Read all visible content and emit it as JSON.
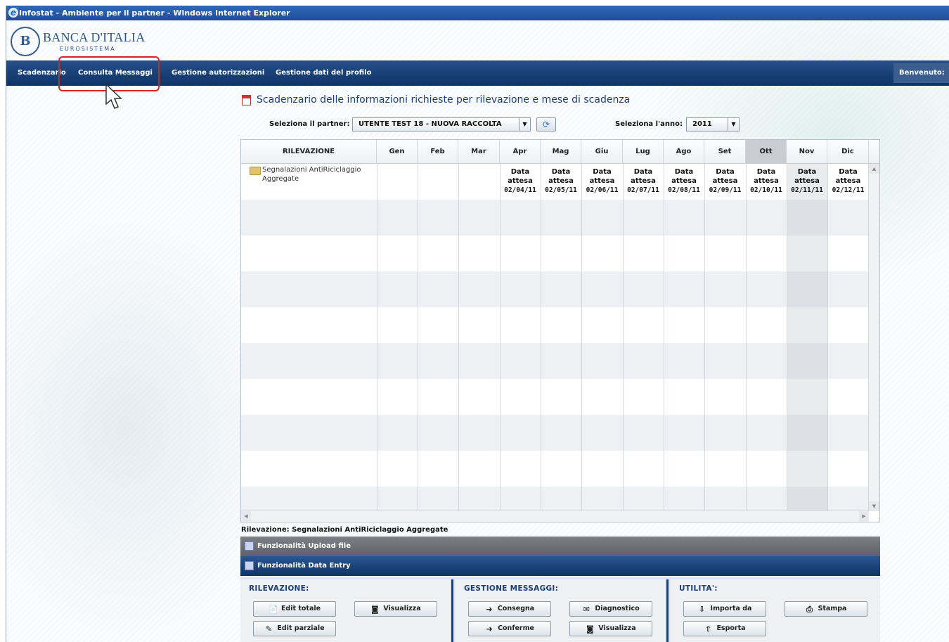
{
  "window": {
    "title": "Infostat - Ambiente per il partner - Windows Internet Explorer"
  },
  "logo": {
    "name": "BANCA D'ITALIA",
    "subtitle": "EUROSISTEMA",
    "mark": "B"
  },
  "nav": {
    "items": [
      {
        "label": "Scadenzario"
      },
      {
        "label": "Consulta Messaggi"
      },
      {
        "label": "Gestione autorizzazioni"
      },
      {
        "label": "Gestione dati del profilo"
      }
    ],
    "welcome": "Benvenuto:"
  },
  "page": {
    "title": "Scadenzario delle informazioni richieste per rilevazione e mese di scadenza"
  },
  "filters": {
    "partner_label": "Seleziona il partner:",
    "partner_value": "UTENTE TEST 18 - NUOVA RACCOLTA",
    "year_label": "Seleziona l'anno:",
    "year_value": "2011"
  },
  "grid": {
    "columns": [
      "RILEVAZIONE",
      "Gen",
      "Feb",
      "Mar",
      "Apr",
      "Mag",
      "Giu",
      "Lug",
      "Ago",
      "Set",
      "Ott",
      "Nov",
      "Dic"
    ],
    "selected_column": "Ott",
    "highlighted_cell_month": "Nov",
    "rows": [
      {
        "name": "Segnalazioni AntiRiciclaggio Aggregate",
        "cells": [
          {
            "month": "Apr",
            "line1": "Data",
            "line2": "attesa",
            "date": "02/04/11"
          },
          {
            "month": "Mag",
            "line1": "Data",
            "line2": "attesa",
            "date": "02/05/11"
          },
          {
            "month": "Giu",
            "line1": "Data",
            "line2": "attesa",
            "date": "02/06/11"
          },
          {
            "month": "Lug",
            "line1": "Data",
            "line2": "attesa",
            "date": "02/07/11"
          },
          {
            "month": "Ago",
            "line1": "Data",
            "line2": "attesa",
            "date": "02/08/11"
          },
          {
            "month": "Set",
            "line1": "Data",
            "line2": "attesa",
            "date": "02/09/11"
          },
          {
            "month": "Ott",
            "line1": "Data",
            "line2": "attesa",
            "date": "02/10/11"
          },
          {
            "month": "Nov",
            "line1": "Data",
            "line2": "attesa",
            "date": "02/11/11"
          },
          {
            "month": "Dic",
            "line1": "Data",
            "line2": "attesa",
            "date": "02/12/11"
          }
        ]
      }
    ]
  },
  "status": "Rilevazione: Segnalazioni AntiRiciclaggio Aggregate",
  "panels": {
    "upload": "Funzionalità Upload file",
    "data_entry": "Funzionalità Data Entry"
  },
  "tools": {
    "rilevazione": {
      "title": "RILEVAZIONE:",
      "edit_totale": "Edit totale",
      "visualizza": "Visualizza",
      "edit_parziale": "Edit parziale"
    },
    "messaggi": {
      "title": "GESTIONE MESSAGGI:",
      "consegna": "Consegna",
      "diagnostico": "Diagnostico",
      "conferme": "Conferme",
      "visualizza": "Visualizza"
    },
    "utilita": {
      "title": "UTILITA':",
      "importa": "Importa da",
      "stampa": "Stampa",
      "esporta": "Esporta"
    }
  }
}
